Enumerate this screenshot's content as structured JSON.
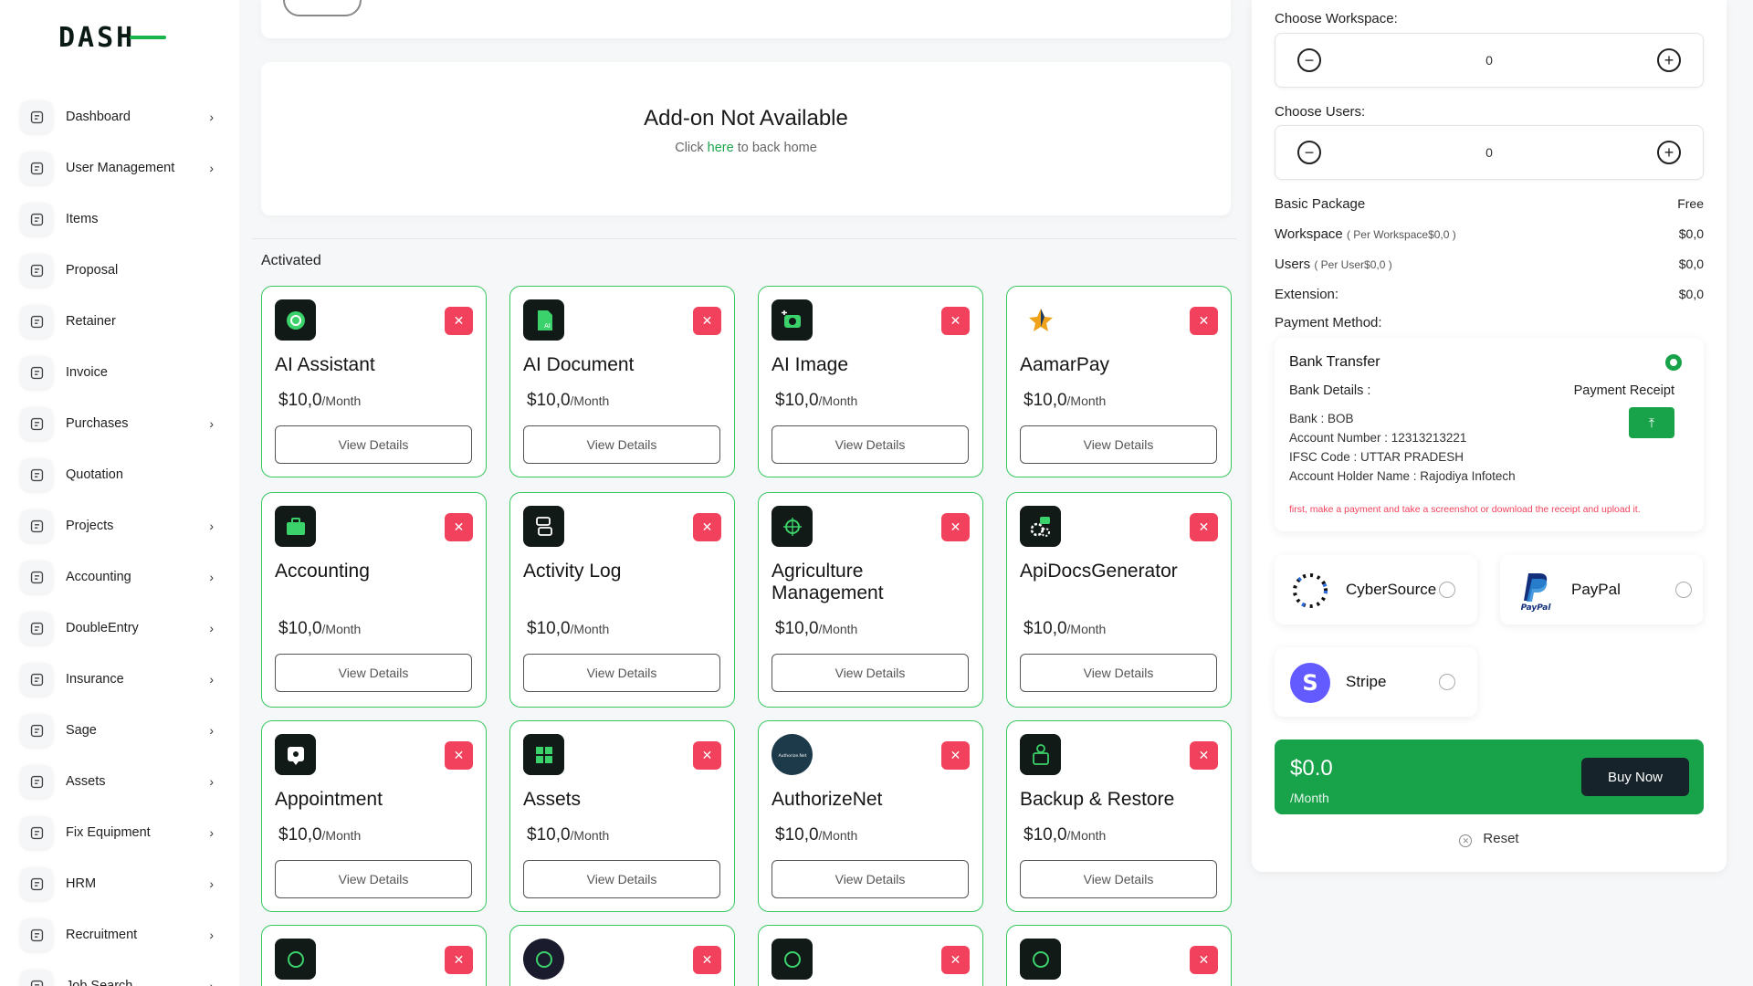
{
  "app": {
    "logo": "DASH"
  },
  "sidebar": {
    "items": [
      {
        "label": "Dashboard",
        "icon": "home-icon",
        "chevron": true
      },
      {
        "label": "User Management",
        "icon": "users-icon",
        "chevron": true
      },
      {
        "label": "Items",
        "icon": "cart-icon",
        "chevron": false
      },
      {
        "label": "Proposal",
        "icon": "proposal-icon",
        "chevron": false
      },
      {
        "label": "Retainer",
        "icon": "retainer-icon",
        "chevron": false
      },
      {
        "label": "Invoice",
        "icon": "invoice-icon",
        "chevron": false
      },
      {
        "label": "Purchases",
        "icon": "cart-icon",
        "chevron": true
      },
      {
        "label": "Quotation",
        "icon": "quotation-icon",
        "chevron": false
      },
      {
        "label": "Projects",
        "icon": "projects-icon",
        "chevron": true
      },
      {
        "label": "Accounting",
        "icon": "accounting-icon",
        "chevron": true
      },
      {
        "label": "DoubleEntry",
        "icon": "scale-icon",
        "chevron": true
      },
      {
        "label": "Insurance",
        "icon": "shield-icon",
        "chevron": true
      },
      {
        "label": "Sage",
        "icon": "sage-icon",
        "chevron": true
      },
      {
        "label": "Assets",
        "icon": "assets-icon",
        "chevron": true
      },
      {
        "label": "Fix Equipment",
        "icon": "archive-icon",
        "chevron": true
      },
      {
        "label": "HRM",
        "icon": "hrm-icon",
        "chevron": true
      },
      {
        "label": "Recruitment",
        "icon": "user-plus-icon",
        "chevron": true
      },
      {
        "label": "Job Search",
        "icon": "job-search-icon",
        "chevron": true
      }
    ],
    "chevron_glyph": "›"
  },
  "notice": {
    "title": "Add-on Not Available",
    "text_before": "Click ",
    "link": "here",
    "text_after": " to back home"
  },
  "activated": {
    "title": "Activated",
    "remove_glyph": "✕",
    "view_label": "View Details",
    "period": "/Month",
    "cards": [
      {
        "name": "AI Assistant",
        "price": "$10,0",
        "icon": "ai-assistant-icon",
        "color": "#111a16"
      },
      {
        "name": "AI Document",
        "price": "$10,0",
        "icon": "ai-document-icon",
        "color": "#111a16"
      },
      {
        "name": "AI Image",
        "price": "$10,0",
        "icon": "ai-image-icon",
        "color": "#111a16"
      },
      {
        "name": "AamarPay",
        "price": "$10,0",
        "icon": "aamarpay-icon",
        "color": "#ffffff"
      },
      {
        "name": "Accounting",
        "price": "$10,0",
        "icon": "accounting-addon-icon",
        "color": "#111a16"
      },
      {
        "name": "Activity Log",
        "price": "$10,0",
        "icon": "activity-log-icon",
        "color": "#111a16"
      },
      {
        "name": "Agriculture Management",
        "price": "$10,0",
        "icon": "agriculture-icon",
        "color": "#111a16"
      },
      {
        "name": "ApiDocsGenerator",
        "price": "$10,0",
        "icon": "api-docs-icon",
        "color": "#111a16"
      },
      {
        "name": "Appointment",
        "price": "$10,0",
        "icon": "appointment-icon",
        "color": "#111a16"
      },
      {
        "name": "Assets",
        "price": "$10,0",
        "icon": "assets-addon-icon",
        "color": "#111a16"
      },
      {
        "name": "AuthorizeNet",
        "price": "$10,0",
        "icon": "authorizenet-icon",
        "color": "#1d3a4a"
      },
      {
        "name": "Backup & Restore",
        "price": "$10,0",
        "icon": "backup-restore-icon",
        "color": "#111a16"
      },
      {
        "name": "",
        "price": "",
        "icon": "addon-icon",
        "color": "#111a16"
      },
      {
        "name": "",
        "price": "",
        "icon": "addon-icon",
        "color": "#1b1b2e"
      },
      {
        "name": "",
        "price": "",
        "icon": "addon-icon",
        "color": "#111a16"
      },
      {
        "name": "",
        "price": "",
        "icon": "addon-icon",
        "color": "#111a16"
      }
    ]
  },
  "order": {
    "workspace_label": "Choose Workspace:",
    "workspace_value": "0",
    "users_label": "Choose Users:",
    "users_value": "0",
    "minus_glyph": "−",
    "plus_glyph": "+",
    "basic_package_label": "Basic Package",
    "basic_package_value": "Free",
    "workspace_row_label": "Workspace",
    "workspace_row_note": "( Per Workspace$0,0 )",
    "workspace_row_value": "$0,0",
    "users_row_label": "Users",
    "users_row_note": "( Per User$0,0 )",
    "users_row_value": "$0,0",
    "extension_label": "Extension:",
    "extension_value": "$0,0",
    "payment_method_label": "Payment Method:",
    "bank": {
      "title": "Bank Transfer",
      "details_label": "Bank Details :",
      "receipt_label": "Payment Receipt",
      "lines": [
        "Bank : BOB",
        "Account Number : 12313213221",
        "IFSC Code : UTTAR PRADESH",
        "Account Holder Name : Rajodiya Infotech"
      ],
      "warning": "first, make a payment and take a screenshot or download the receipt and upload it.",
      "upload_glyph": "⤒"
    },
    "gateways": [
      {
        "name": "CyberSource",
        "icon": "cybersource-icon"
      },
      {
        "name": "PayPal",
        "icon": "paypal-icon"
      },
      {
        "name": "Stripe",
        "icon": "stripe-icon"
      }
    ],
    "total_amount": "$0.0",
    "total_period": "/Month",
    "buy_label": "Buy Now",
    "reset_label": "Reset",
    "accent": "#18a34a",
    "danger": "#f2415c"
  }
}
